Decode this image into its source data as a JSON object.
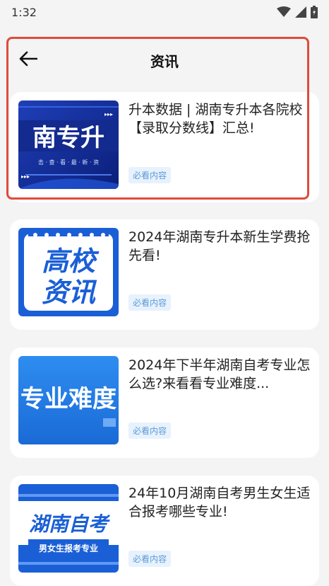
{
  "status_bar": {
    "time": "1:32"
  },
  "header": {
    "title": "资讯"
  },
  "articles": [
    {
      "title": "升本数据 | 湖南专升本各院校【录取分数线】汇总!",
      "tag": "必看内容",
      "thumb_text": "南专升",
      "thumb_sub": "击 · 查 · 看 · 最 · 新 · 资"
    },
    {
      "title": "2024年湖南专升本新生学费抢先看!",
      "tag": "必看内容",
      "thumb_line1": "高校",
      "thumb_line2": "资讯"
    },
    {
      "title": "2024年下半年湖南自考专业怎么选?来看看专业难度...",
      "tag": "必看内容",
      "thumb_text": "专业难度"
    },
    {
      "title": "24年10月湖南自考男生女生适合报考哪些专业!",
      "tag": "必看内容",
      "thumb_text": "湖南自考",
      "thumb_sub": "男女生报考专业"
    }
  ],
  "colors": {
    "accent_red": "#e04b3a",
    "brand_blue": "#1a5fd6",
    "tag_bg": "#e8f2fd",
    "tag_text": "#5e9bd8"
  }
}
